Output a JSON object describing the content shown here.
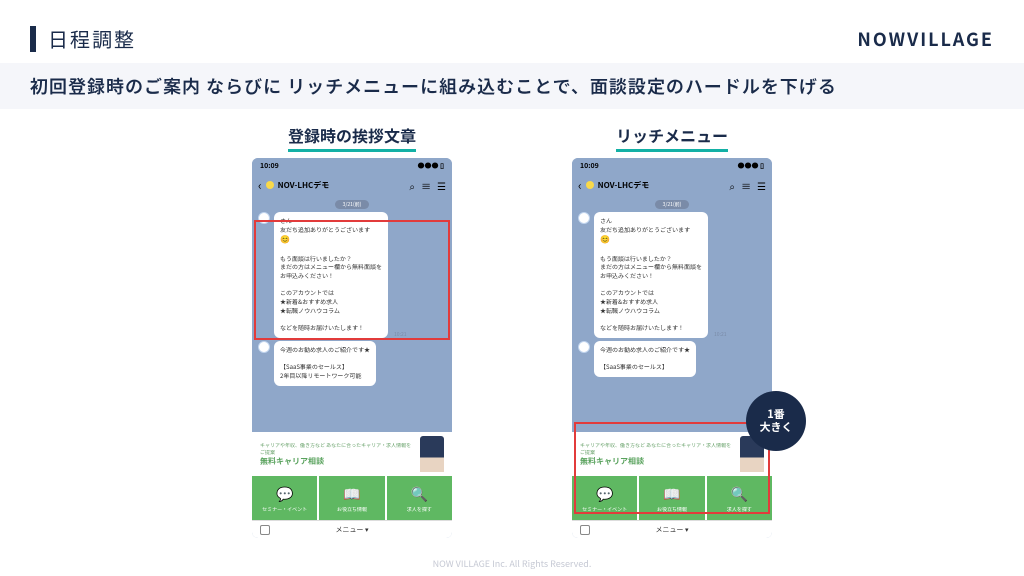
{
  "header": {
    "title": "日程調整",
    "brand": "NOWVILLAGE"
  },
  "subtitle": "初回登録時のご案内 ならびに リッチメニューに組み込むことで、面談設定のハードルを下げる",
  "columns": {
    "left": {
      "title": "登録時の挨拶文章"
    },
    "right": {
      "title": "リッチメニュー"
    }
  },
  "phone": {
    "time": "10:09",
    "chatTitle": "NOV-LHCデモ",
    "dayLabel": "3/21(前)",
    "menuFooter": "メニュー ▾",
    "msg1": {
      "l1": "さん",
      "l2": "友だち追加ありがとうございます",
      "l3": "😊",
      "l4": "もう面談は行いましたか？",
      "l5": "まだの方はメニュー欄から無料面談を",
      "l6": "お申込みください！",
      "l7": "このアカウントでは",
      "l8": "★新着&おすすめ求人",
      "l9": "★転職ノウハウコラム",
      "l10": "などを随時お届けいたします！"
    },
    "msg2": {
      "l1": "今週のお勧め求人のご紹介です★",
      "l2": "【SaaS事業のセールス】",
      "l3": "2年目以降リモートワーク可能"
    },
    "timestamp": "10:21",
    "richmenu": {
      "topSmall": "キャリアや年収、働き方など\nあなたに合ったキャリア・求人情報をご提案",
      "topTitle": "無料キャリア相談",
      "cells": [
        "セミナー・イベント",
        "お役立ち情報",
        "求人を探す"
      ]
    }
  },
  "badge": {
    "l1": "1番",
    "l2": "大きく"
  },
  "footer": "NOW VILLAGE Inc. All Rights Reserved."
}
